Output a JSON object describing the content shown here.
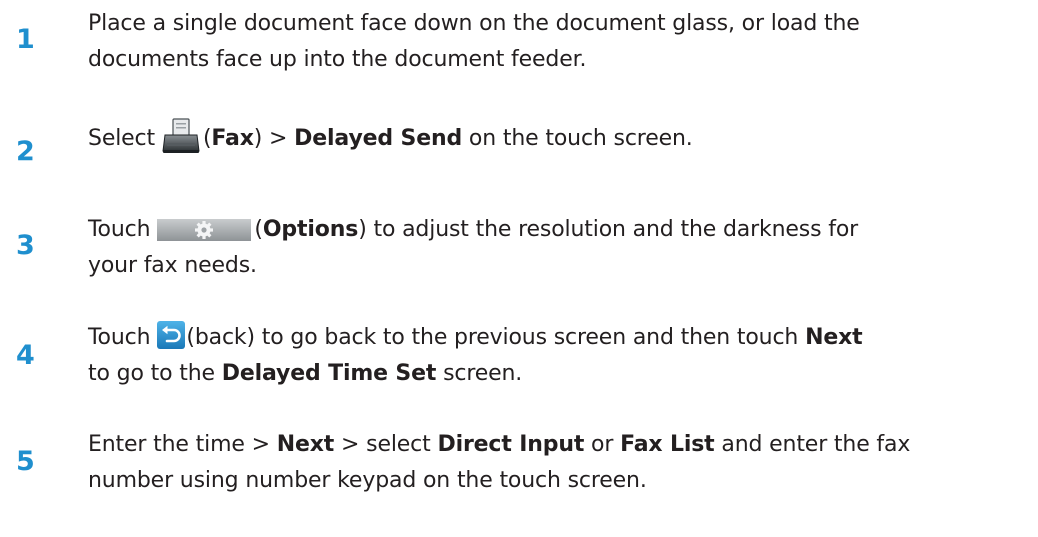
{
  "steps": [
    {
      "number": "1",
      "line1": "Place a single document face down on the document glass, or load the",
      "line2": "documents face up into the document feeder."
    },
    {
      "number": "2",
      "pre": "Select",
      "paren_open": "(",
      "bold1": "Fax",
      "mid": ") > ",
      "bold2": "Delayed Send",
      "post": " on the touch screen."
    },
    {
      "number": "3",
      "pre": "Touch",
      "paren_open": "(",
      "bold1": "Options",
      "post": ") to adjust the resolution and the darkness for",
      "line2": "your fax needs."
    },
    {
      "number": "4",
      "pre": "Touch",
      "post1": "(back) to go back to the previous screen and then touch ",
      "bold1": "Next",
      "line2_pre": "to go to the ",
      "bold2": "Delayed Time Set",
      "line2_post": " screen."
    },
    {
      "number": "5",
      "pre": "Enter the time > ",
      "bold1": "Next",
      "mid1": " > select ",
      "bold2": "Direct Input",
      "mid2": " or ",
      "bold3": "Fax List",
      "post": " and enter the fax",
      "line2": "number using number keypad on the touch screen."
    }
  ],
  "icons": {
    "fax": "fax-icon",
    "options": "options-gear-icon",
    "back": "back-arrow-icon"
  },
  "colors": {
    "step_number": "#1f8fce",
    "text": "#231f20"
  }
}
